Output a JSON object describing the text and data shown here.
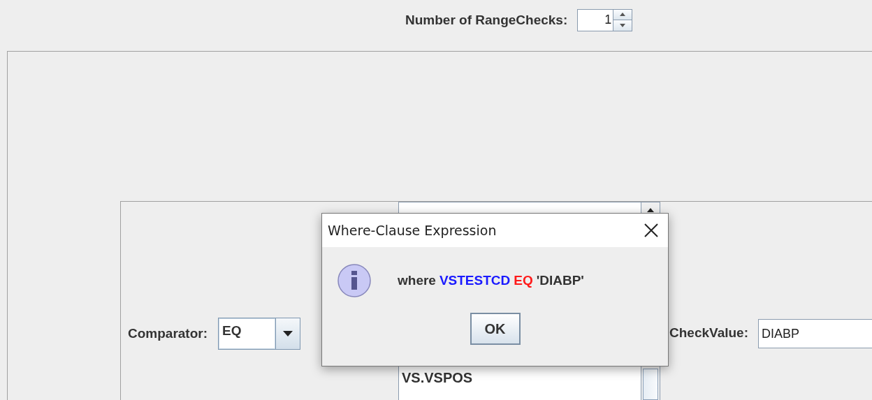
{
  "range_checks": {
    "label": "Number of RangeChecks:",
    "value": "1"
  },
  "comparator": {
    "label": "Comparator:",
    "value": "EQ"
  },
  "variable_list": {
    "items": [
      {
        "text": "VS.VSPOS"
      }
    ]
  },
  "check_value": {
    "label": "CheckValue:",
    "value": "DIABP"
  },
  "dialog": {
    "title": "Where-Clause Expression",
    "message_parts": [
      {
        "text": "where",
        "color": "#333333"
      },
      {
        "text": "VSTESTCD",
        "color": "#1a1aff"
      },
      {
        "text": "EQ",
        "color": "#ff1a1a"
      },
      {
        "text": "'DIABP'",
        "color": "#333333"
      }
    ],
    "button": "OK"
  }
}
